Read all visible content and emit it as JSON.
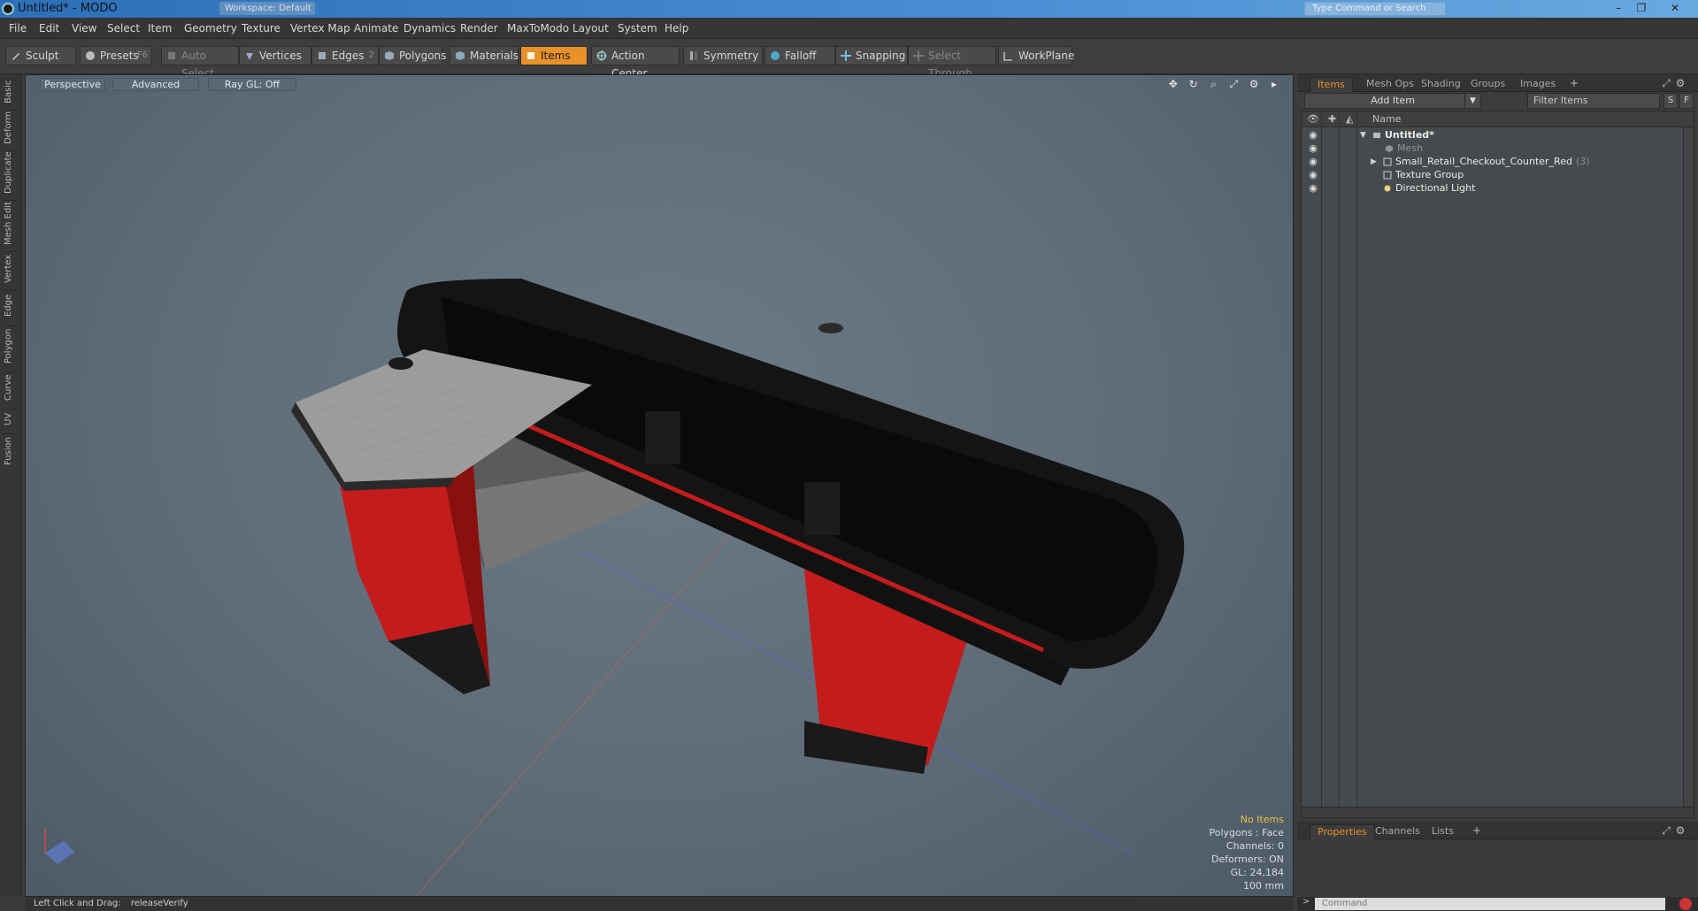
{
  "window": {
    "title": "Untitled* - MODO",
    "layout_label": "Workspace: Default",
    "search_placeholder": "Type Command or Search",
    "controls": [
      "–",
      "❐",
      "✕"
    ]
  },
  "menu": [
    "File",
    "Edit",
    "View",
    "Select",
    "Item",
    "Geometry",
    "Texture",
    "Vertex Map",
    "Animate",
    "Dynamics",
    "Render",
    "MaxToModo",
    "Layout",
    "System",
    "Help"
  ],
  "toolbar": {
    "sculpt": "Sculpt",
    "presets": "Presets",
    "presets_key": "F6",
    "auto_select": "Auto Select",
    "vertices": "Vertices",
    "edges": "Edges",
    "edges_key": "2",
    "polygons": "Polygons",
    "materials": "Materials",
    "items": "Items",
    "action_center": "Action Center",
    "symmetry": "Symmetry",
    "falloff": "Falloff",
    "snapping": "Snapping",
    "select_through": "Select Through",
    "workplane": "WorkPlane"
  },
  "left_tabs": [
    "Basic",
    "Deform",
    "Duplicate",
    "Mesh Edit",
    "Vertex",
    "Edge",
    "Polygon",
    "Curve",
    "UV",
    "Fusion"
  ],
  "viewport": {
    "view": "Perspective",
    "shading": "Advanced",
    "raygl": "Ray GL: Off",
    "info": {
      "no_items": "No Items",
      "polygons": "Polygons : Face",
      "channels": "Channels: 0",
      "deformers": "Deformers: ON",
      "gl": "GL: 24,184",
      "unit": "100 mm"
    }
  },
  "right_panel": {
    "tabs": [
      "Items",
      "Mesh Ops",
      "Shading",
      "Groups",
      "Images"
    ],
    "add_item": "Add Item",
    "filter_placeholder": "Filter Items",
    "btn_s": "S",
    "btn_f": "F",
    "column_name": "Name",
    "tree": [
      {
        "label": "Untitled*",
        "bold": true
      },
      {
        "label": "Mesh",
        "dim": true
      },
      {
        "label": "Small_Retail_Checkout_Counter_Red",
        "count": "(3)"
      },
      {
        "label": "Texture Group"
      },
      {
        "label": "Directional Light"
      }
    ],
    "bottom_tabs": [
      "Properties",
      "Channels",
      "Lists"
    ]
  },
  "status": {
    "hint": "Left Click and Drag:",
    "action": "releaseVerify"
  },
  "command": {
    "placeholder": "Command"
  },
  "colors": {
    "accent": "#e8902a",
    "counter_red": "#c41c1c",
    "counter_black": "#141414",
    "shelf_gray": "#9c9c9c"
  }
}
